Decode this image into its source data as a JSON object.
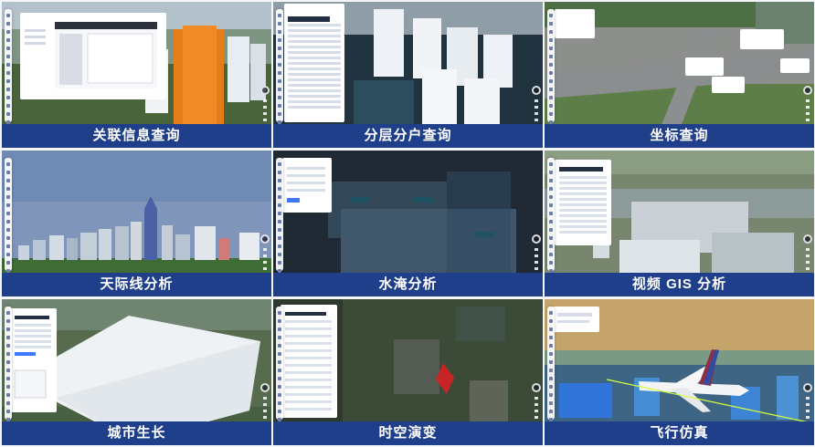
{
  "tiles": [
    {
      "caption": "关联信息查询",
      "icon": "building-icon"
    },
    {
      "caption": "分层分户查询",
      "icon": "layers-icon"
    },
    {
      "caption": "坐标查询",
      "icon": "coordinate-icon"
    },
    {
      "caption": "天际线分析",
      "icon": "skyline-icon"
    },
    {
      "caption": "水淹分析",
      "icon": "water-icon"
    },
    {
      "caption": "视频 GIS 分析",
      "icon": "video-icon"
    },
    {
      "caption": "城市生长",
      "icon": "city-growth-icon"
    },
    {
      "caption": "时空演变",
      "icon": "timeline-icon"
    },
    {
      "caption": "飞行仿真",
      "icon": "airplane-icon"
    }
  ],
  "colors": {
    "caption_bg": "#1f3f8b",
    "caption_text": "#ffffff",
    "panel_bg": "#ffffff",
    "accent": "#3f78ff"
  }
}
